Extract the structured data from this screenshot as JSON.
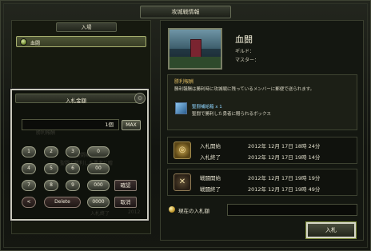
{
  "window": {
    "title": "攻城戦情報"
  },
  "left": {
    "header": "入場",
    "entry_label": "血闘"
  },
  "bid_dialog": {
    "title": "入札金額",
    "amount_value": "1個",
    "max_label": "MAX",
    "keys": [
      "1",
      "2",
      "3",
      "4",
      "5",
      "6",
      "7",
      "8",
      "9",
      "<",
      "0",
      "00",
      "000",
      "Delete",
      "0000"
    ],
    "confirm_label": "確認",
    "cancel_label": "取消"
  },
  "right": {
    "castle_name": "血闘",
    "guild_label": "ギルド：",
    "master_label": "マスター：",
    "reward": {
      "title": "勝利報酬",
      "description": "勝利報酬は勝利時に攻城戦に残っているメンバーに郵便で送られます。",
      "item_name": "聖闘補給箱 x 1",
      "item_desc": "聖闘で勝利した勇者に贈られるボックス"
    },
    "bid_schedule": {
      "start_label": "入札開始",
      "start_value": "2012年 12月 17日 18時 24分",
      "end_label": "入札終了",
      "end_value": "2012年 12月 17日 19時 14分"
    },
    "battle_schedule": {
      "start_label": "戦闘開始",
      "start_value": "2012年 12月 17日 19時 19分",
      "end_label": "戦闘終了",
      "end_value": "2012年 12月 17日 19時 49分"
    },
    "current_bid_label": "現在の入札額",
    "current_bid_value": "",
    "enter_button": "入札"
  },
  "ghost_text": {
    "line1": "勝利報酬",
    "line2": "聖闘補給箱 x 1",
    "line3": "聖闘で勝利した勇者に贈",
    "line4": "入札終了",
    "line5": "2012"
  },
  "colors": {
    "accent_gold": "#d6b45d",
    "item_blue": "#8fd5ff"
  }
}
